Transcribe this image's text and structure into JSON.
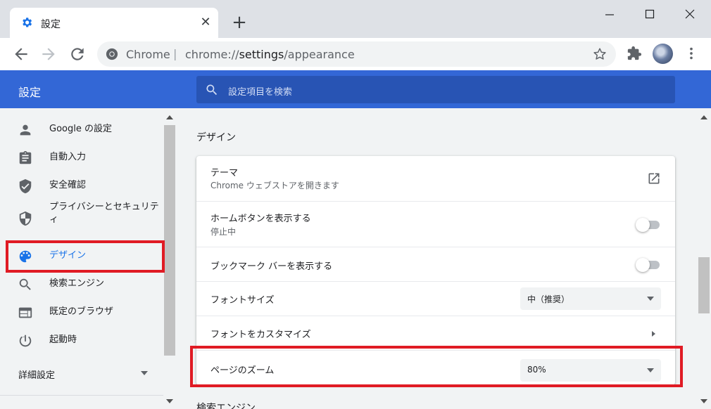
{
  "browser": {
    "tab_title": "設定",
    "new_tab_icon": "plus-icon",
    "url_site": "Chrome",
    "url_separator": "|",
    "url_prefix": "chrome://",
    "url_host": "settings",
    "url_path": "/appearance"
  },
  "header": {
    "title": "設定",
    "search_placeholder": "設定項目を検索"
  },
  "sidebar": {
    "items": [
      {
        "label": "Google の設定",
        "icon": "person-icon"
      },
      {
        "label": "自動入力",
        "icon": "clipboard-icon"
      },
      {
        "label": "安全確認",
        "icon": "shield-check-icon"
      },
      {
        "label": "プライバシーとセキュリティ",
        "icon": "security-shield-icon"
      },
      {
        "label": "デザイン",
        "icon": "palette-icon",
        "active": true
      },
      {
        "label": "検索エンジン",
        "icon": "search-icon"
      },
      {
        "label": "既定のブラウザ",
        "icon": "browser-window-icon"
      },
      {
        "label": "起動時",
        "icon": "power-icon"
      }
    ],
    "privacy_line1": "プライバシーとセキュリテ",
    "privacy_line2": "ィ",
    "advanced_label": "詳細設定"
  },
  "main": {
    "section_title": "デザイン",
    "theme_label": "テーマ",
    "theme_sub": "Chrome ウェブストアを開きます",
    "home_button_label": "ホームボタンを表示する",
    "home_button_sub": "停止中",
    "bookmark_bar_label": "ブックマーク バーを表示する",
    "font_size_label": "フォントサイズ",
    "font_size_value": "中（推奨）",
    "customize_fonts_label": "フォントをカスタマイズ",
    "page_zoom_label": "ページのズーム",
    "page_zoom_value": "80%",
    "next_section_title": "検索エンジン"
  },
  "colors": {
    "header_blue": "#3367d6",
    "search_blue": "#2854b4",
    "active_blue": "#1a73e8",
    "highlight_red": "#e01b24"
  }
}
